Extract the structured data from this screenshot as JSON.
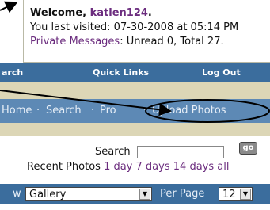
{
  "welcome": {
    "greeting_prefix": "Welcome, ",
    "username": "katlen124",
    "greeting_suffix": ".",
    "last_visited": "You last visited: 07-30-2008 at 05:14 PM",
    "pm_label": "Private Messages",
    "pm_stats": ": Unread 0, Total 27."
  },
  "navbar": {
    "search": "arch",
    "quick_links": "Quick Links",
    "log_out": "Log Out"
  },
  "breadcrumb": {
    "home": "Home",
    "sep1": "·",
    "search": "Search",
    "sep2": "·",
    "photos": "Pro",
    "sep3": "·",
    "upload": "Upload Photos"
  },
  "panel": {
    "search_label": "Search",
    "go_label": "go",
    "recent_label": "Recent Photos",
    "recent_links": [
      "1 day",
      "7 days",
      "14 days",
      "all"
    ],
    "view_label": "w",
    "view_value": "Gallery",
    "per_page_label": "Per Page",
    "per_page_value": "12"
  },
  "colors": {
    "nav_blue": "#3b6d9d",
    "crumb_blue": "#5d89b5",
    "beige": "#dcd6b6",
    "link_purple": "#6b2c7e"
  }
}
